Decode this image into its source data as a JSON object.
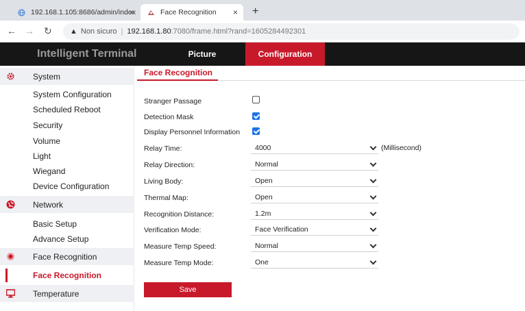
{
  "browser": {
    "tabs": [
      {
        "title": "192.168.1.105:8686/admin/index",
        "close": "×"
      },
      {
        "title": "Face Recognition",
        "close": "×"
      }
    ],
    "new_tab": "+",
    "address": {
      "security_label": "Non sicuro",
      "separator": "|",
      "host": "192.168.1.80",
      "rest": ":7080/frame.html?rand=1605284492301"
    }
  },
  "app": {
    "brand": "Intelligent Terminal",
    "menu": {
      "picture": "Picture",
      "configuration": "Configuration"
    }
  },
  "sidebar": {
    "system": {
      "label": "System",
      "items": [
        "System Configuration",
        "Scheduled Reboot",
        "Security",
        "Volume",
        "Light",
        "Wiegand",
        "Device Configuration"
      ]
    },
    "network": {
      "label": "Network",
      "items": [
        "Basic Setup",
        "Advance Setup"
      ]
    },
    "face": {
      "label": "Face Recognition",
      "active_item": "Face Recognition"
    },
    "temperature": {
      "label": "Temperature"
    }
  },
  "content": {
    "title": "Face Recognition",
    "stranger_passage": {
      "label": "Stranger Passage",
      "checked": false
    },
    "detection_mask": {
      "label": "Detection Mask",
      "checked": true
    },
    "display_personnel": {
      "label": "Display Personnel Information",
      "checked": true
    },
    "relay_time": {
      "label": "Relay Time:",
      "value": "4000",
      "unit": "(Millisecond)"
    },
    "relay_direction": {
      "label": "Relay Direction:",
      "value": "Normal"
    },
    "living_body": {
      "label": "Living Body:",
      "value": "Open"
    },
    "thermal_map": {
      "label": "Thermal Map:",
      "value": "Open"
    },
    "recognition_distance": {
      "label": "Recognition Distance:",
      "value": "1.2m"
    },
    "verification_mode": {
      "label": "Verification Mode:",
      "value": "Face Verification"
    },
    "measure_temp_speed": {
      "label": "Measure Temp Speed:",
      "value": "Normal"
    },
    "measure_temp_mode": {
      "label": "Measure Temp Mode:",
      "value": "One"
    },
    "save_label": "Save"
  },
  "colors": {
    "accent": "#c8192a",
    "header": "#161616",
    "checkbox": "#1a73e8"
  }
}
